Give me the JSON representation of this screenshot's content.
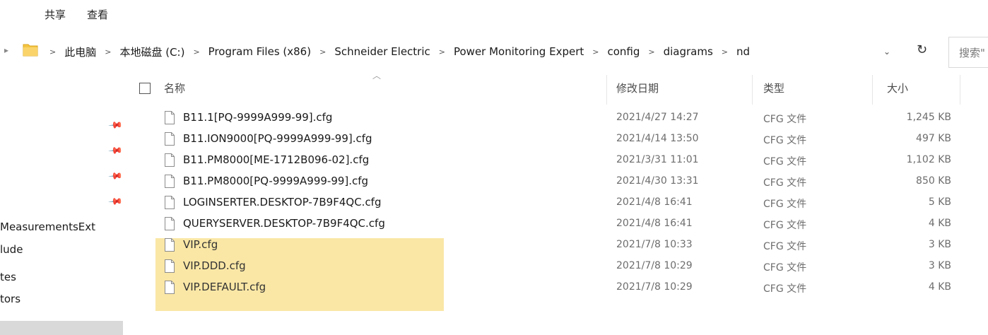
{
  "ribbon": {
    "tabs": [
      "共享",
      "查看"
    ]
  },
  "address": {
    "crumbs": [
      "此电脑",
      "本地磁盘 (C:)",
      "Program Files (x86)",
      "Schneider Electric",
      "Power Monitoring Expert",
      "config",
      "diagrams",
      "nd"
    ]
  },
  "search": {
    "placeholder": "搜索\""
  },
  "columns": {
    "name": "名称",
    "date": "修改日期",
    "type": "类型",
    "size": "大小"
  },
  "nav": {
    "items": [
      "MeasurementsExt",
      "lude",
      "tes",
      "tors"
    ]
  },
  "files": [
    {
      "name": "B11.1[PQ-9999A999-99].cfg",
      "date": "2021/4/27 14:27",
      "type": "CFG 文件",
      "size": "1,245 KB",
      "highlighted": false
    },
    {
      "name": "B11.ION9000[PQ-9999A999-99].cfg",
      "date": "2021/4/14 13:50",
      "type": "CFG 文件",
      "size": "497 KB",
      "highlighted": false
    },
    {
      "name": "B11.PM8000[ME-1712B096-02].cfg",
      "date": "2021/3/31 11:01",
      "type": "CFG 文件",
      "size": "1,102 KB",
      "highlighted": false
    },
    {
      "name": "B11.PM8000[PQ-9999A999-99].cfg",
      "date": "2021/4/30 13:31",
      "type": "CFG 文件",
      "size": "850 KB",
      "highlighted": false
    },
    {
      "name": "LOGINSERTER.DESKTOP-7B9F4QC.cfg",
      "date": "2021/4/8 16:41",
      "type": "CFG 文件",
      "size": "5 KB",
      "highlighted": false
    },
    {
      "name": "QUERYSERVER.DESKTOP-7B9F4QC.cfg",
      "date": "2021/4/8 16:41",
      "type": "CFG 文件",
      "size": "4 KB",
      "highlighted": false
    },
    {
      "name": "VIP.cfg",
      "date": "2021/7/8 10:33",
      "type": "CFG 文件",
      "size": "3 KB",
      "highlighted": true
    },
    {
      "name": "VIP.DDD.cfg",
      "date": "2021/7/8 10:29",
      "type": "CFG 文件",
      "size": "3 KB",
      "highlighted": true
    },
    {
      "name": "VIP.DEFAULT.cfg",
      "date": "2021/7/8 10:29",
      "type": "CFG 文件",
      "size": "4 KB",
      "highlighted": true
    }
  ],
  "colors": {
    "highlight": "#fae7a6",
    "folder": "#f5c542"
  }
}
